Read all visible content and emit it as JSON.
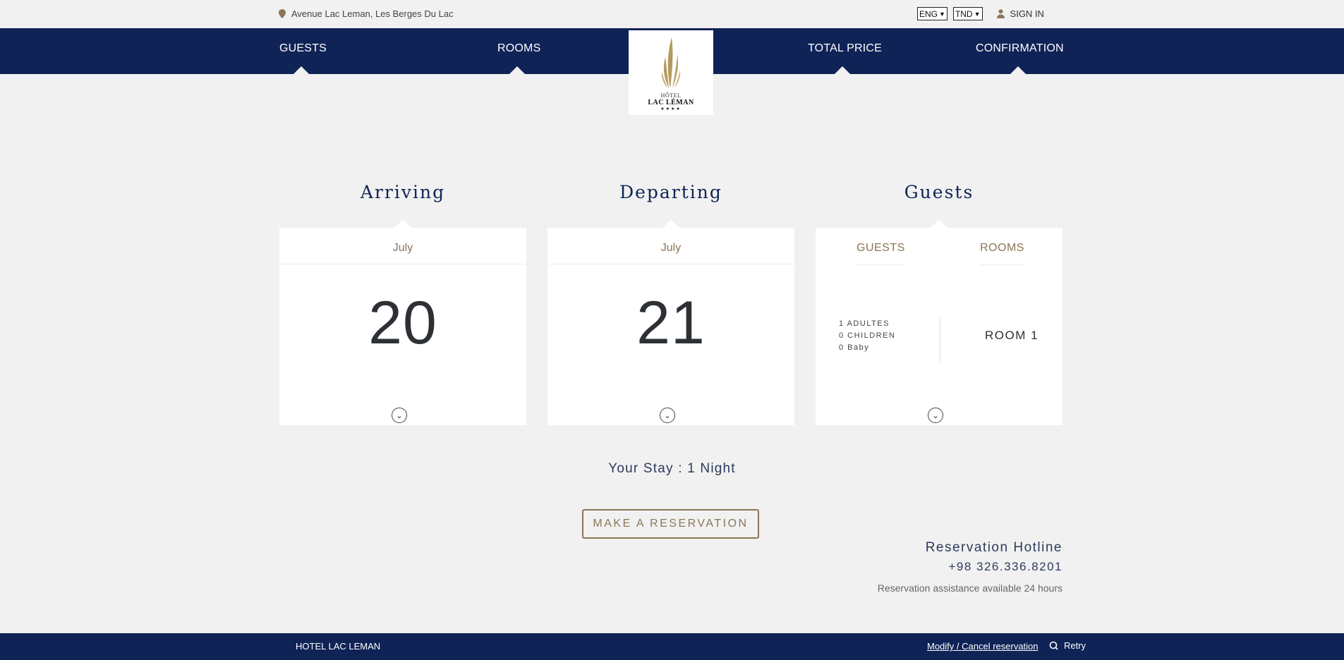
{
  "topbar": {
    "address": "Avenue Lac Leman, Les Berges Du Lac",
    "language_selected": "ENG",
    "currency_selected": "TND",
    "signin_label": "SIGN IN"
  },
  "nav": {
    "guests": "GUESTS",
    "rooms": "ROOMS",
    "total_price": "TOTAL PRICE",
    "confirmation": "CONFIRMATION"
  },
  "logo": {
    "line1": "HÔTEL",
    "line2": "LAC LÉMAN",
    "stars": "★★★★"
  },
  "booking": {
    "arriving": {
      "title": "Arriving",
      "month": "July",
      "day": "20"
    },
    "departing": {
      "title": "Departing",
      "month": "July",
      "day": "21"
    },
    "guests": {
      "title": "Guests",
      "tab_guests": "GUESTS",
      "tab_rooms": "ROOMS",
      "adults": "1 ADULTES",
      "children": "0 CHILDREN",
      "baby": "0 Baby",
      "room": "ROOM 1"
    }
  },
  "stay_text": "Your Stay : 1 Night",
  "reserve_label": "MAKE A RESERVATION",
  "hotline": {
    "title": "Reservation Hotline",
    "phone": "+98 326.336.8201",
    "note": "Reservation assistance available 24 hours"
  },
  "footer": {
    "name": "HOTEL LAC LEMAN",
    "modify_link": "Modify / Cancel reservation",
    "retry": "Retry"
  },
  "colors": {
    "navy": "#0f2356",
    "gold": "#8b7657",
    "background": "#f1f1f1"
  }
}
